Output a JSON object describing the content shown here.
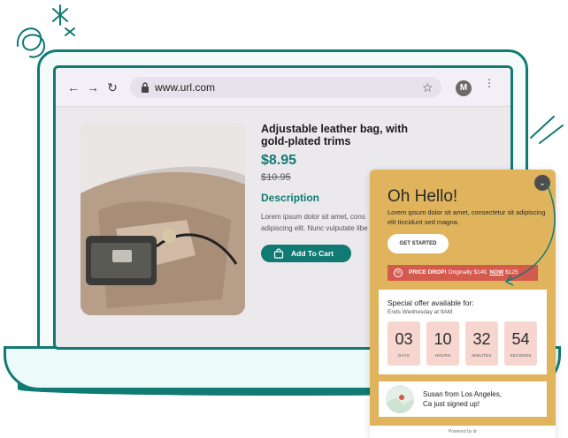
{
  "browser": {
    "url": "www.url.com",
    "avatar_letter": "M",
    "icons": {
      "back": "arrow-left-icon",
      "forward": "arrow-right-icon",
      "reload": "reload-icon",
      "lock": "lock-icon",
      "bookmark": "star-icon",
      "menu": "kebab-icon"
    }
  },
  "product": {
    "title": "Adjustable leather bag, with gold-plated trims",
    "price": "$8.95",
    "old_price": "$10.95",
    "description_heading": "Description",
    "description_line1": "Lorem ipsum dolor sit amet, cons",
    "description_line2": "adipiscing elit. Nunc vulputate libe",
    "add_to_cart_label": "Add To Cart"
  },
  "popup": {
    "title": "Oh Hello!",
    "text": "Lorem ipsum dolor sit amet, consectetur sit adipiscing elit tincidunt sed magna.",
    "cta_label": "GET STARTED",
    "price_drop": {
      "label": "PRICE DROP!",
      "text": "Originally $149.",
      "now_label": "NOW",
      "now_price": "$125"
    },
    "offer": {
      "title": "Special offer available for:",
      "subtitle": "Ends Wednesday at 9AM",
      "countdown": [
        {
          "value": "03",
          "unit": "DAYS"
        },
        {
          "value": "10",
          "unit": "HOURS"
        },
        {
          "value": "32",
          "unit": "MINUTES"
        },
        {
          "value": "54",
          "unit": "SECONDS"
        }
      ]
    },
    "social_proof": {
      "line1": "Susan  from Los Angeles,",
      "line2": "Ca just signed up!"
    },
    "powered_by": "Powered by"
  },
  "colors": {
    "teal": "#117a72",
    "popup_bg": "#dfb45d",
    "price_drop": "#d35a4c",
    "count_bg": "#f6d6cf"
  }
}
